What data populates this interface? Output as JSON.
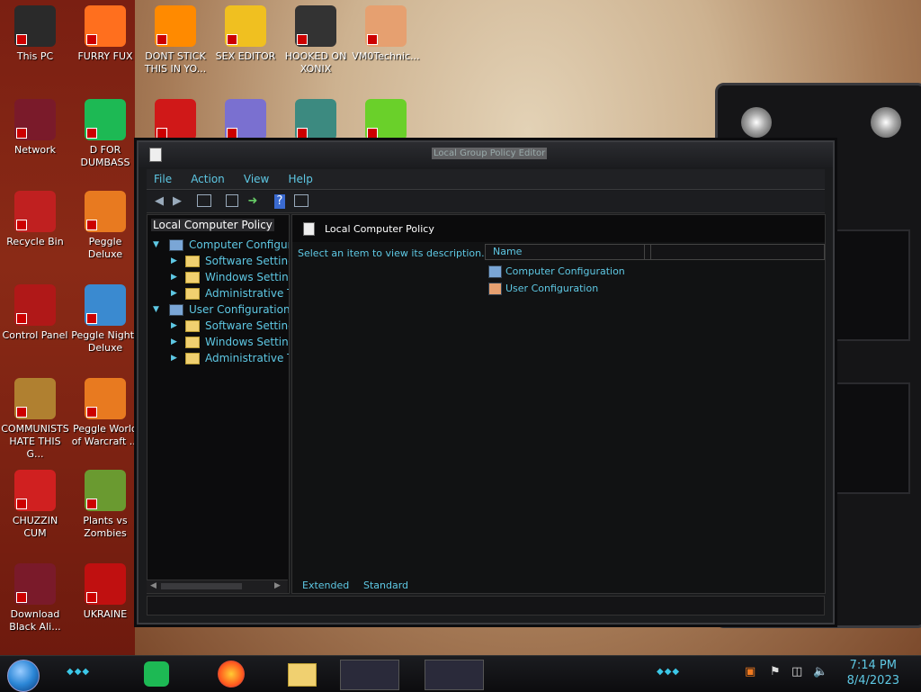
{
  "desktop": {
    "icons": [
      {
        "label": "This PC",
        "color": "#2a2a2a"
      },
      {
        "label": "FURRY FUX",
        "color": "#ff6f1e"
      },
      {
        "label": "DONT STICK THIS IN YO...",
        "color": "#ff8a00"
      },
      {
        "label": "SEX EDITOR",
        "color": "#f0c020"
      },
      {
        "label": "HOOKED ON XONIX",
        "color": "#333333"
      },
      {
        "label": "VM0Technic...",
        "color": "#e6a070"
      },
      {
        "label": "Network",
        "color": "#7a1a2a"
      },
      {
        "label": "D FOR DUMBASS",
        "color": "#1db954"
      },
      {
        "label": "",
        "color": "#d01818"
      },
      {
        "label": "",
        "color": "#7a70d0"
      },
      {
        "label": "",
        "color": "#3c8a80"
      },
      {
        "label": "",
        "color": "#6ad02a"
      },
      {
        "label": "Recycle Bin",
        "color": "#c02020"
      },
      {
        "label": "Peggle Deluxe",
        "color": "#e87a20"
      },
      {
        "label": "Control Panel",
        "color": "#b01818"
      },
      {
        "label": "Peggle Nights Deluxe",
        "color": "#3a8ad0"
      },
      {
        "label": "COMMUNISTS HATE THIS G...",
        "color": "#b08030"
      },
      {
        "label": "Peggle World of Warcraft ...",
        "color": "#e87a20"
      },
      {
        "label": "CHUZZIN CUM",
        "color": "#d02020"
      },
      {
        "label": "Plants vs Zombies",
        "color": "#6a9a30"
      },
      {
        "label": "Download Black Ali...",
        "color": "#7a1a2a"
      },
      {
        "label": "UKRAINE",
        "color": "#c01010"
      }
    ]
  },
  "window": {
    "title": "Local Group Policy Editor",
    "menu": [
      "File",
      "Action",
      "View",
      "Help"
    ],
    "toolbar": {
      "back": "back-arrow-icon",
      "forward": "forward-arrow-icon",
      "show_hide_tree": "console-tree-icon",
      "properties": "properties-icon",
      "export": "export-list-icon",
      "help": "help-icon",
      "console": "console-icon"
    },
    "tree": {
      "root": "Local Computer Policy",
      "nodes": [
        {
          "label": "Computer Configuration",
          "level": 1
        },
        {
          "label": "Software Settings",
          "level": 2
        },
        {
          "label": "Windows Settings",
          "level": 2
        },
        {
          "label": "Administrative Templates",
          "level": 2
        },
        {
          "label": "User Configuration",
          "level": 1
        },
        {
          "label": "Software Settings",
          "level": 2
        },
        {
          "label": "Windows Settings",
          "level": 2
        },
        {
          "label": "Administrative Templates",
          "level": 2
        }
      ]
    },
    "content": {
      "header": "Local Computer Policy",
      "description": "Select an item to view its description.",
      "column": "Name",
      "items": [
        "Computer Configuration",
        "User Configuration"
      ],
      "tabs": [
        "Extended",
        "Standard"
      ]
    }
  },
  "taskbar": {
    "time": "7:14 PM",
    "date": "8/4/2023",
    "apps": [
      "spotify-icon",
      "firefox-icon",
      "file-explorer-icon",
      "app-window-icon",
      "notepad-icon"
    ],
    "accent": "#5ec8e4"
  }
}
